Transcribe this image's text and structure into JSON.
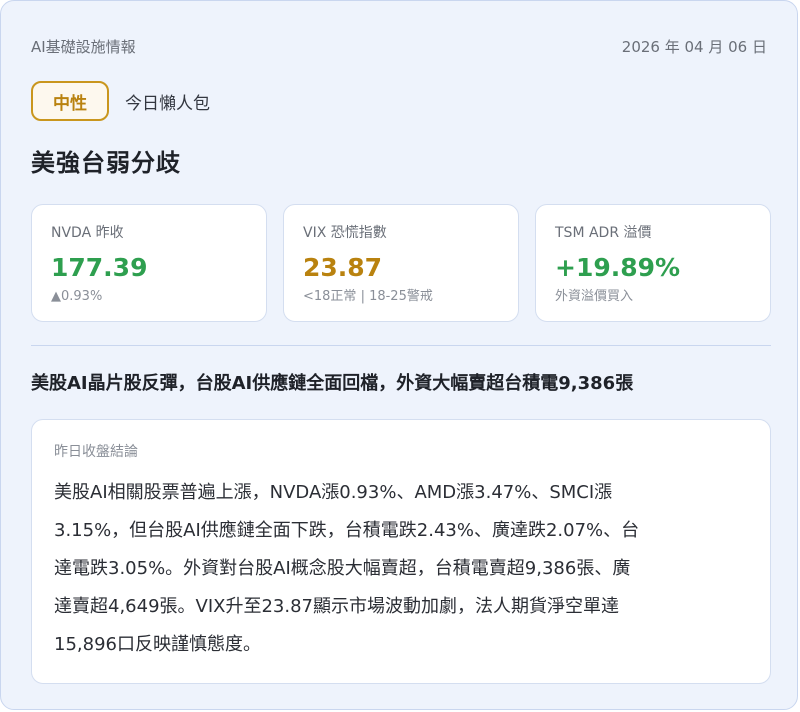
{
  "header": {
    "source": "AI基礎設施情報",
    "date": "2026 年 04 月 06 日"
  },
  "sentiment": {
    "badge": "中性",
    "label": "今日懶人包"
  },
  "headline": "美強台弱分歧",
  "metrics": [
    {
      "label": "NVDA 昨收",
      "value": "177.39",
      "sub": "▲0.93%",
      "value_color": "#2e9f4f"
    },
    {
      "label": "VIX 恐慌指數",
      "value": "23.87",
      "sub": "<18正常 | 18-25警戒",
      "value_color": "#b9820f"
    },
    {
      "label": "TSM ADR 溢價",
      "value": "+19.89%",
      "sub": "外資溢價買入",
      "value_color": "#2e9f4f"
    }
  ],
  "summary": "美股AI晶片股反彈，台股AI供應鏈全面回檔，外資大幅賣超台積電9,386張",
  "conclusion": {
    "title": "昨日收盤結論",
    "lines": [
      "美股AI相關股票普遍上漲，NVDA漲0.93%、AMD漲3.47%、SMCI漲",
      "3.15%，但台股AI供應鏈全面下跌，台積電跌2.43%、廣達跌2.07%、台",
      "達電跌3.05%。外資對台股AI概念股大幅賣超，台積電賣超9,386張、廣",
      "達賣超4,649張。VIX升至23.87顯示市場波動加劇，法人期貨淨空單達",
      "15,896口反映謹慎態度。"
    ]
  }
}
